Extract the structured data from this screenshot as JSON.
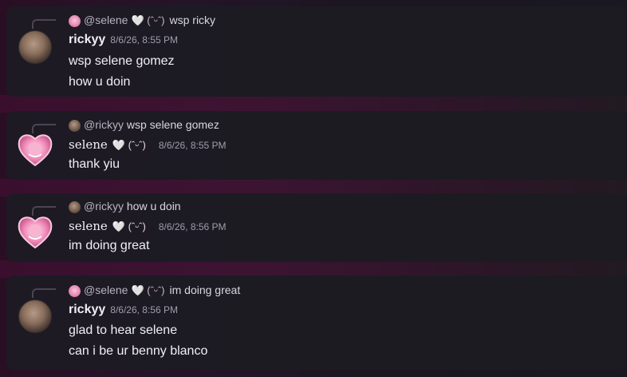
{
  "messages": [
    {
      "author": "rickyy",
      "timestamp": "8/6/26, 8:55 PM",
      "reply": {
        "mention": "@selene",
        "decor": "🤍 (ˆᵕˆ)",
        "text": "wsp ricky"
      },
      "lines": [
        "wsp selene gomez",
        "how u doin"
      ],
      "avatar": "ricky-avatar"
    },
    {
      "author": "selene",
      "author_decor": "🤍 (ˆᵕˆ)",
      "timestamp": "8/6/26, 8:55 PM",
      "reply": {
        "mention": "@rickyy",
        "text": "wsp selene gomez"
      },
      "lines": [
        "thank yiu"
      ],
      "avatar": "selene-heart-avatar"
    },
    {
      "author": "selene",
      "author_decor": "🤍 (ˆᵕˆ)",
      "timestamp": "8/6/26, 8:56 PM",
      "reply": {
        "mention": "@rickyy",
        "text": "how u doin"
      },
      "lines": [
        "im doing great"
      ],
      "avatar": "selene-heart-avatar"
    },
    {
      "author": "rickyy",
      "timestamp": "8/6/26, 8:56 PM",
      "reply": {
        "mention": "@selene",
        "decor": "🤍 (ˆᵕˆ)",
        "text": "im doing great"
      },
      "lines": [
        "glad to hear selene",
        "can i be ur benny blanco"
      ],
      "avatar": "ricky-avatar"
    }
  ],
  "colors": {
    "background": "#2a0f24",
    "bubble": "#1c1b22",
    "timestamp": "#a19dab"
  }
}
